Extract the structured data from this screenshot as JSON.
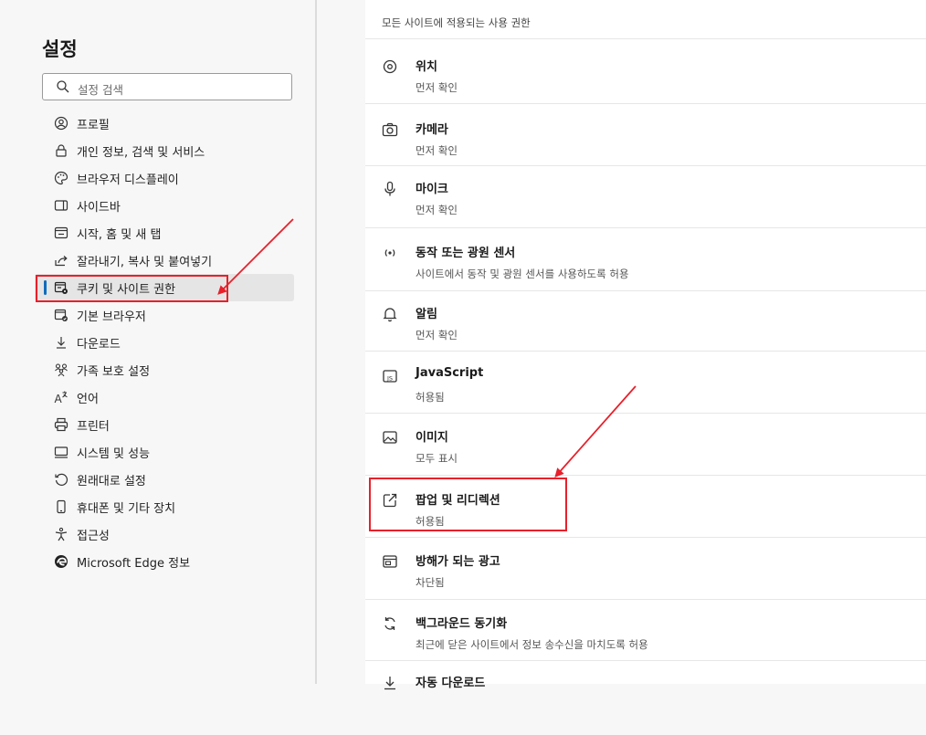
{
  "sidebar": {
    "title": "설정",
    "search_placeholder": "설정 검색",
    "items": [
      {
        "label": "프로필",
        "icon": "profile-icon"
      },
      {
        "label": "개인 정보, 검색 및 서비스",
        "icon": "lock-icon"
      },
      {
        "label": "브라우저 디스플레이",
        "icon": "palette-icon"
      },
      {
        "label": "사이드바",
        "icon": "sidebar-icon"
      },
      {
        "label": "시작, 홈 및 새 탭",
        "icon": "home-tab-icon"
      },
      {
        "label": "잘라내기, 복사 및 붙여넣기",
        "icon": "share-icon"
      },
      {
        "label": "쿠키 및 사이트 권한",
        "icon": "cookie-permissions-icon",
        "selected": true
      },
      {
        "label": "기본 브라우저",
        "icon": "default-browser-icon"
      },
      {
        "label": "다운로드",
        "icon": "download-icon"
      },
      {
        "label": "가족 보호 설정",
        "icon": "family-icon"
      },
      {
        "label": "언어",
        "icon": "language-icon"
      },
      {
        "label": "프린터",
        "icon": "printer-icon"
      },
      {
        "label": "시스템 및 성능",
        "icon": "system-icon"
      },
      {
        "label": "원래대로 설정",
        "icon": "reset-icon"
      },
      {
        "label": "휴대폰 및 기타 장치",
        "icon": "phone-icon"
      },
      {
        "label": "접근성",
        "icon": "accessibility-icon"
      },
      {
        "label": "Microsoft Edge 정보",
        "icon": "edge-logo-icon"
      }
    ]
  },
  "main": {
    "section_title": "모든 사이트에 적용되는 사용 권한",
    "permissions": [
      {
        "name": "위치",
        "desc": "먼저 확인",
        "icon": "location-icon"
      },
      {
        "name": "카메라",
        "desc": "먼저 확인",
        "icon": "camera-icon"
      },
      {
        "name": "마이크",
        "desc": "먼저 확인",
        "icon": "microphone-icon"
      },
      {
        "name": "동작 또는 광원 센서",
        "desc": "사이트에서 동작 및 광원 센서를 사용하도록 허용",
        "icon": "sensor-icon"
      },
      {
        "name": "알림",
        "desc": "먼저 확인",
        "icon": "bell-icon"
      },
      {
        "name": "JavaScript",
        "desc": "허용됨",
        "icon": "javascript-icon"
      },
      {
        "name": "이미지",
        "desc": "모두 표시",
        "icon": "image-icon"
      },
      {
        "name": "팝업 및 리디렉션",
        "desc": "허용됨",
        "icon": "popup-icon"
      },
      {
        "name": "방해가 되는 광고",
        "desc": "차단됨",
        "icon": "ads-icon"
      },
      {
        "name": "백그라운드 동기화",
        "desc": "최근에 닫은 사이트에서 정보 송수신을 마치도록 허용",
        "icon": "sync-icon"
      },
      {
        "name": "자동 다운로드",
        "desc": "",
        "icon": "auto-download-icon"
      }
    ]
  },
  "colors": {
    "accent": "#0f6cbd",
    "annotation": "#e8202a"
  }
}
